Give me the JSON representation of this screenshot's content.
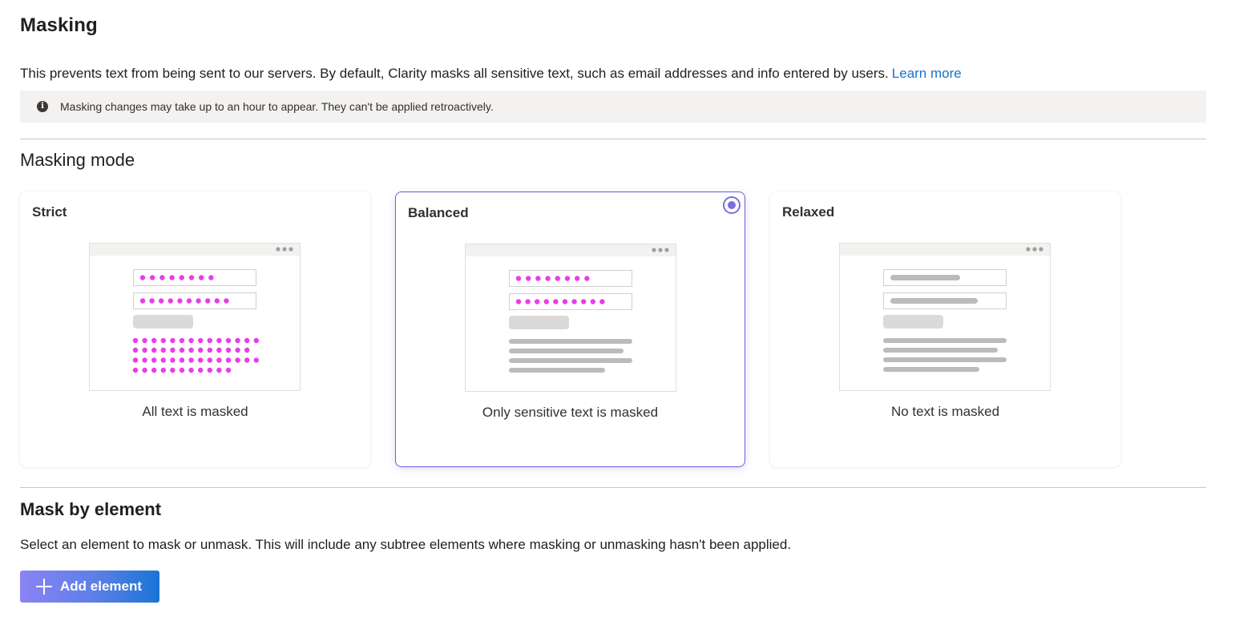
{
  "header": {
    "title": "Masking",
    "description": "This prevents text from being sent to our servers. By default, Clarity masks all sensitive text, such as email addresses and info entered by users.",
    "learn_more": "Learn more",
    "info_icon": "info-icon",
    "info_text": "Masking changes may take up to an hour to appear. They can't be applied retroactively."
  },
  "masking_mode": {
    "title": "Masking mode",
    "selected": "Balanced",
    "options": [
      {
        "label": "Strict",
        "caption": "All text is masked"
      },
      {
        "label": "Balanced",
        "caption": "Only sensitive text is masked"
      },
      {
        "label": "Relaxed",
        "caption": "No text is masked"
      }
    ]
  },
  "mask_by_element": {
    "title": "Mask by element",
    "description": "Select an element to mask or unmask. This will include any subtree elements where masking or unmasking hasn't been applied.",
    "add_button": "Add element",
    "add_icon": "plus-icon"
  },
  "colors": {
    "mask_dot": "#e83ee8",
    "accent": "#7b6fe0",
    "link": "#1a73c8",
    "info_bar_bg": "#f3f2f1",
    "placeholder_line": "#bdbbb9"
  }
}
